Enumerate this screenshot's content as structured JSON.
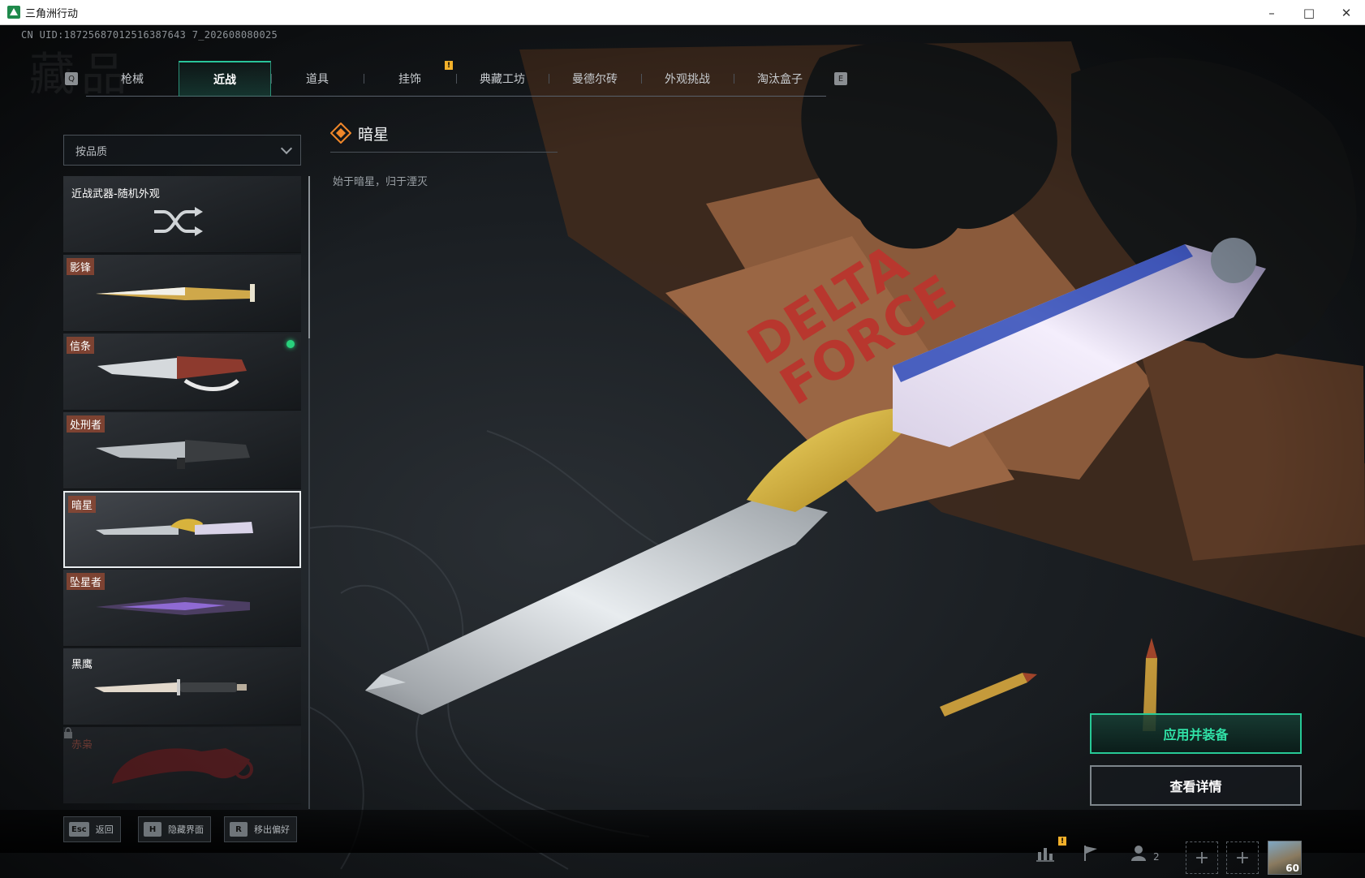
{
  "window": {
    "title": "三角洲行动",
    "min_icon": "minimize-icon",
    "max_icon": "maximize-icon",
    "close_icon": "close-icon"
  },
  "uid": "CN UID:18725687012516387643 7_202608080025",
  "tabs": {
    "left_key": "Q",
    "right_key": "E",
    "items": [
      {
        "label": "枪械"
      },
      {
        "label": "近战",
        "active": true
      },
      {
        "label": "道具"
      },
      {
        "label": "挂饰"
      },
      {
        "label": "典藏工坊"
      },
      {
        "label": "曼德尔砖"
      },
      {
        "label": "外观挑战"
      },
      {
        "label": "淘汰盒子"
      }
    ],
    "alert": "!"
  },
  "filter": {
    "value": "按品质"
  },
  "list": {
    "random": {
      "label": "近战武器-随机外观",
      "icon": "shuffle-icon"
    },
    "items": [
      {
        "label": "影锋"
      },
      {
        "label": "信条",
        "equipped": true
      },
      {
        "label": "处刑者"
      },
      {
        "label": "暗星",
        "selected": true
      },
      {
        "label": "坠星者"
      },
      {
        "label": "黑鹰"
      },
      {
        "label": "赤枭",
        "locked": true
      }
    ]
  },
  "detail": {
    "name": "暗星",
    "rarity_icon": "rarity-diamond-icon",
    "description": "始于暗星，归于湮灭"
  },
  "actions": {
    "apply": "应用并装备",
    "details": "查看详情"
  },
  "bottom": {
    "hints": [
      {
        "key": "Esc",
        "label": "返回"
      },
      {
        "key": "H",
        "label": "隐藏界面"
      },
      {
        "key": "R",
        "label": "移出偏好"
      }
    ],
    "friend_count": "2",
    "level": "60",
    "alert": "!"
  },
  "colors": {
    "accent": "#27c996",
    "tag": "#8c4632",
    "alert": "#f2b02a",
    "equipped": "#28d17c"
  }
}
